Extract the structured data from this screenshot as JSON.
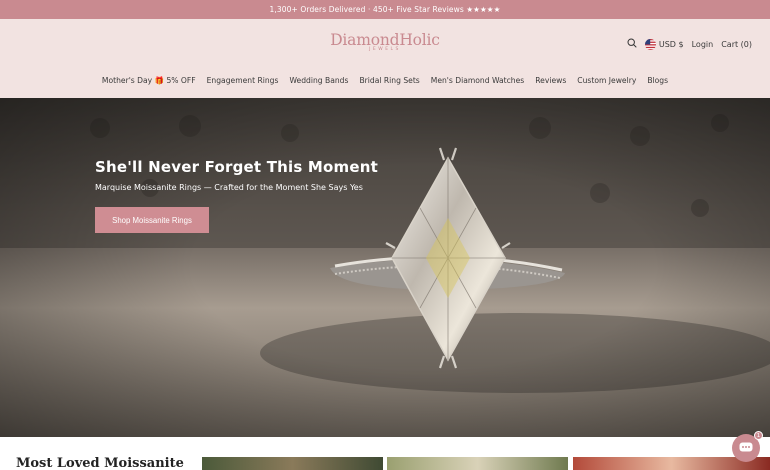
{
  "announcement": {
    "text": "1,300+ Orders Delivered · 450+ Five Star Reviews ★★★★★"
  },
  "header": {
    "logo_main": "DiamondHolic",
    "logo_sub": "JEWELS",
    "currency": "USD $",
    "login": "Login",
    "cart": "Cart (0)"
  },
  "nav": {
    "items": [
      {
        "label": "Mother's Day 🎁 5% OFF"
      },
      {
        "label": "Engagement Rings"
      },
      {
        "label": "Wedding Bands"
      },
      {
        "label": "Bridal Ring Sets"
      },
      {
        "label": "Men's Diamond Watches"
      },
      {
        "label": "Reviews"
      },
      {
        "label": "Custom Jewelry"
      },
      {
        "label": "Blogs"
      }
    ]
  },
  "hero": {
    "title": "She'll Never Forget This Moment",
    "subtitle": "Marquise Moissanite Rings — Crafted for the Moment She Says Yes",
    "cta": "Shop Moissanite Rings"
  },
  "featured": {
    "title": "Most Loved Moissanite"
  },
  "chat": {
    "badge": "1"
  },
  "colors": {
    "brand": "#c98a90",
    "header_bg": "#f2e3e1",
    "button": "#cf8d93"
  },
  "icons": [
    "search-icon",
    "us-flag-icon",
    "chat-icon"
  ]
}
